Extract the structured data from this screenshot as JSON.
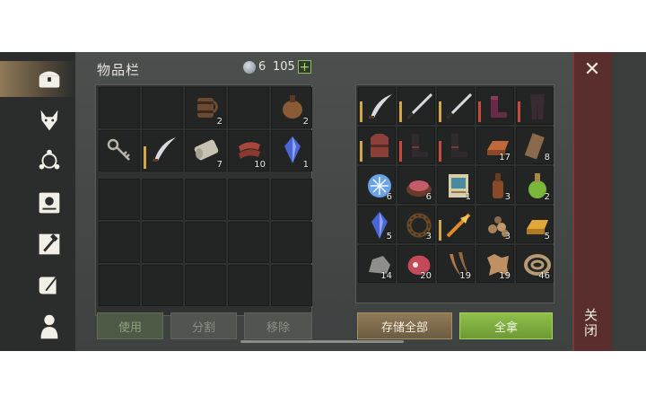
{
  "header": {
    "title": "物品栏",
    "coins": "6",
    "gems": "105",
    "plus": "+"
  },
  "sidebar": {
    "tabs": [
      {
        "icon": "chest-icon",
        "active": true
      },
      {
        "icon": "wolf-head-icon",
        "active": false
      },
      {
        "icon": "crafting-nodes-icon",
        "active": false
      },
      {
        "icon": "sun-book-icon",
        "active": false
      },
      {
        "icon": "hammer-map-icon",
        "active": false
      },
      {
        "icon": "scroll-quill-icon",
        "active": false
      },
      {
        "icon": "character-icon",
        "active": false
      }
    ]
  },
  "inventory": {
    "top_slots": [
      {
        "icon": "",
        "qty": ""
      },
      {
        "icon": "",
        "qty": ""
      },
      {
        "icon": "wooden-mug-icon",
        "qty": "2"
      },
      {
        "icon": "",
        "qty": ""
      },
      {
        "icon": "leather-flask-icon",
        "qty": "2"
      },
      {
        "icon": "key-icon",
        "qty": ""
      },
      {
        "icon": "saber-icon",
        "qty": "",
        "durability": "gold"
      },
      {
        "icon": "cloth-roll-icon",
        "qty": "7"
      },
      {
        "icon": "meat-strips-icon",
        "qty": "10"
      },
      {
        "icon": "blue-crystal-icon",
        "qty": "1"
      }
    ],
    "empty_rows": 3,
    "empty_cols": 5
  },
  "buttons": {
    "use": "使用",
    "split": "分割",
    "remove": "移除",
    "store_all": "存储全部",
    "take_all": "全拿"
  },
  "storage": {
    "slots": [
      {
        "icon": "saber-icon",
        "qty": "",
        "durability": "gold"
      },
      {
        "icon": "katana-icon",
        "qty": "",
        "durability": "gold"
      },
      {
        "icon": "katana-icon",
        "qty": "",
        "durability": "gold"
      },
      {
        "icon": "purple-boots-icon",
        "qty": "",
        "durability": "red"
      },
      {
        "icon": "dark-leggings-icon",
        "qty": "",
        "durability": "red"
      },
      {
        "icon": "red-armor-icon",
        "qty": "",
        "durability": "gold"
      },
      {
        "icon": "dark-boots-icon",
        "qty": "",
        "durability": "red"
      },
      {
        "icon": "dark-boots-icon",
        "qty": "",
        "durability": "red"
      },
      {
        "icon": "copper-ingot-icon",
        "qty": "17"
      },
      {
        "icon": "wood-plank-icon",
        "qty": "8"
      },
      {
        "icon": "frost-orb-icon",
        "qty": "6"
      },
      {
        "icon": "meat-bowl-icon",
        "qty": "6"
      },
      {
        "icon": "map-scroll-icon",
        "qty": "1"
      },
      {
        "icon": "brown-bottle-icon",
        "qty": "3"
      },
      {
        "icon": "green-potion-icon",
        "qty": "2"
      },
      {
        "icon": "blue-crystal-icon",
        "qty": "5"
      },
      {
        "icon": "thorn-wreath-icon",
        "qty": "3"
      },
      {
        "icon": "flame-sword-icon",
        "qty": "",
        "durability": "gold"
      },
      {
        "icon": "stones-pile-icon",
        "qty": "3"
      },
      {
        "icon": "gold-ingot-icon",
        "qty": "5"
      },
      {
        "icon": "stone-icon",
        "qty": "14"
      },
      {
        "icon": "raw-meat-icon",
        "qty": "20"
      },
      {
        "icon": "fang-icon",
        "qty": "19"
      },
      {
        "icon": "leather-hide-icon",
        "qty": "19"
      },
      {
        "icon": "rope-coil-icon",
        "qty": "46"
      }
    ]
  },
  "close": {
    "label": "关闭",
    "x": "✕"
  },
  "colors": {
    "gold": "#d4a64a",
    "red": "#c84a3a",
    "accent_green": "#8fbf4a"
  }
}
